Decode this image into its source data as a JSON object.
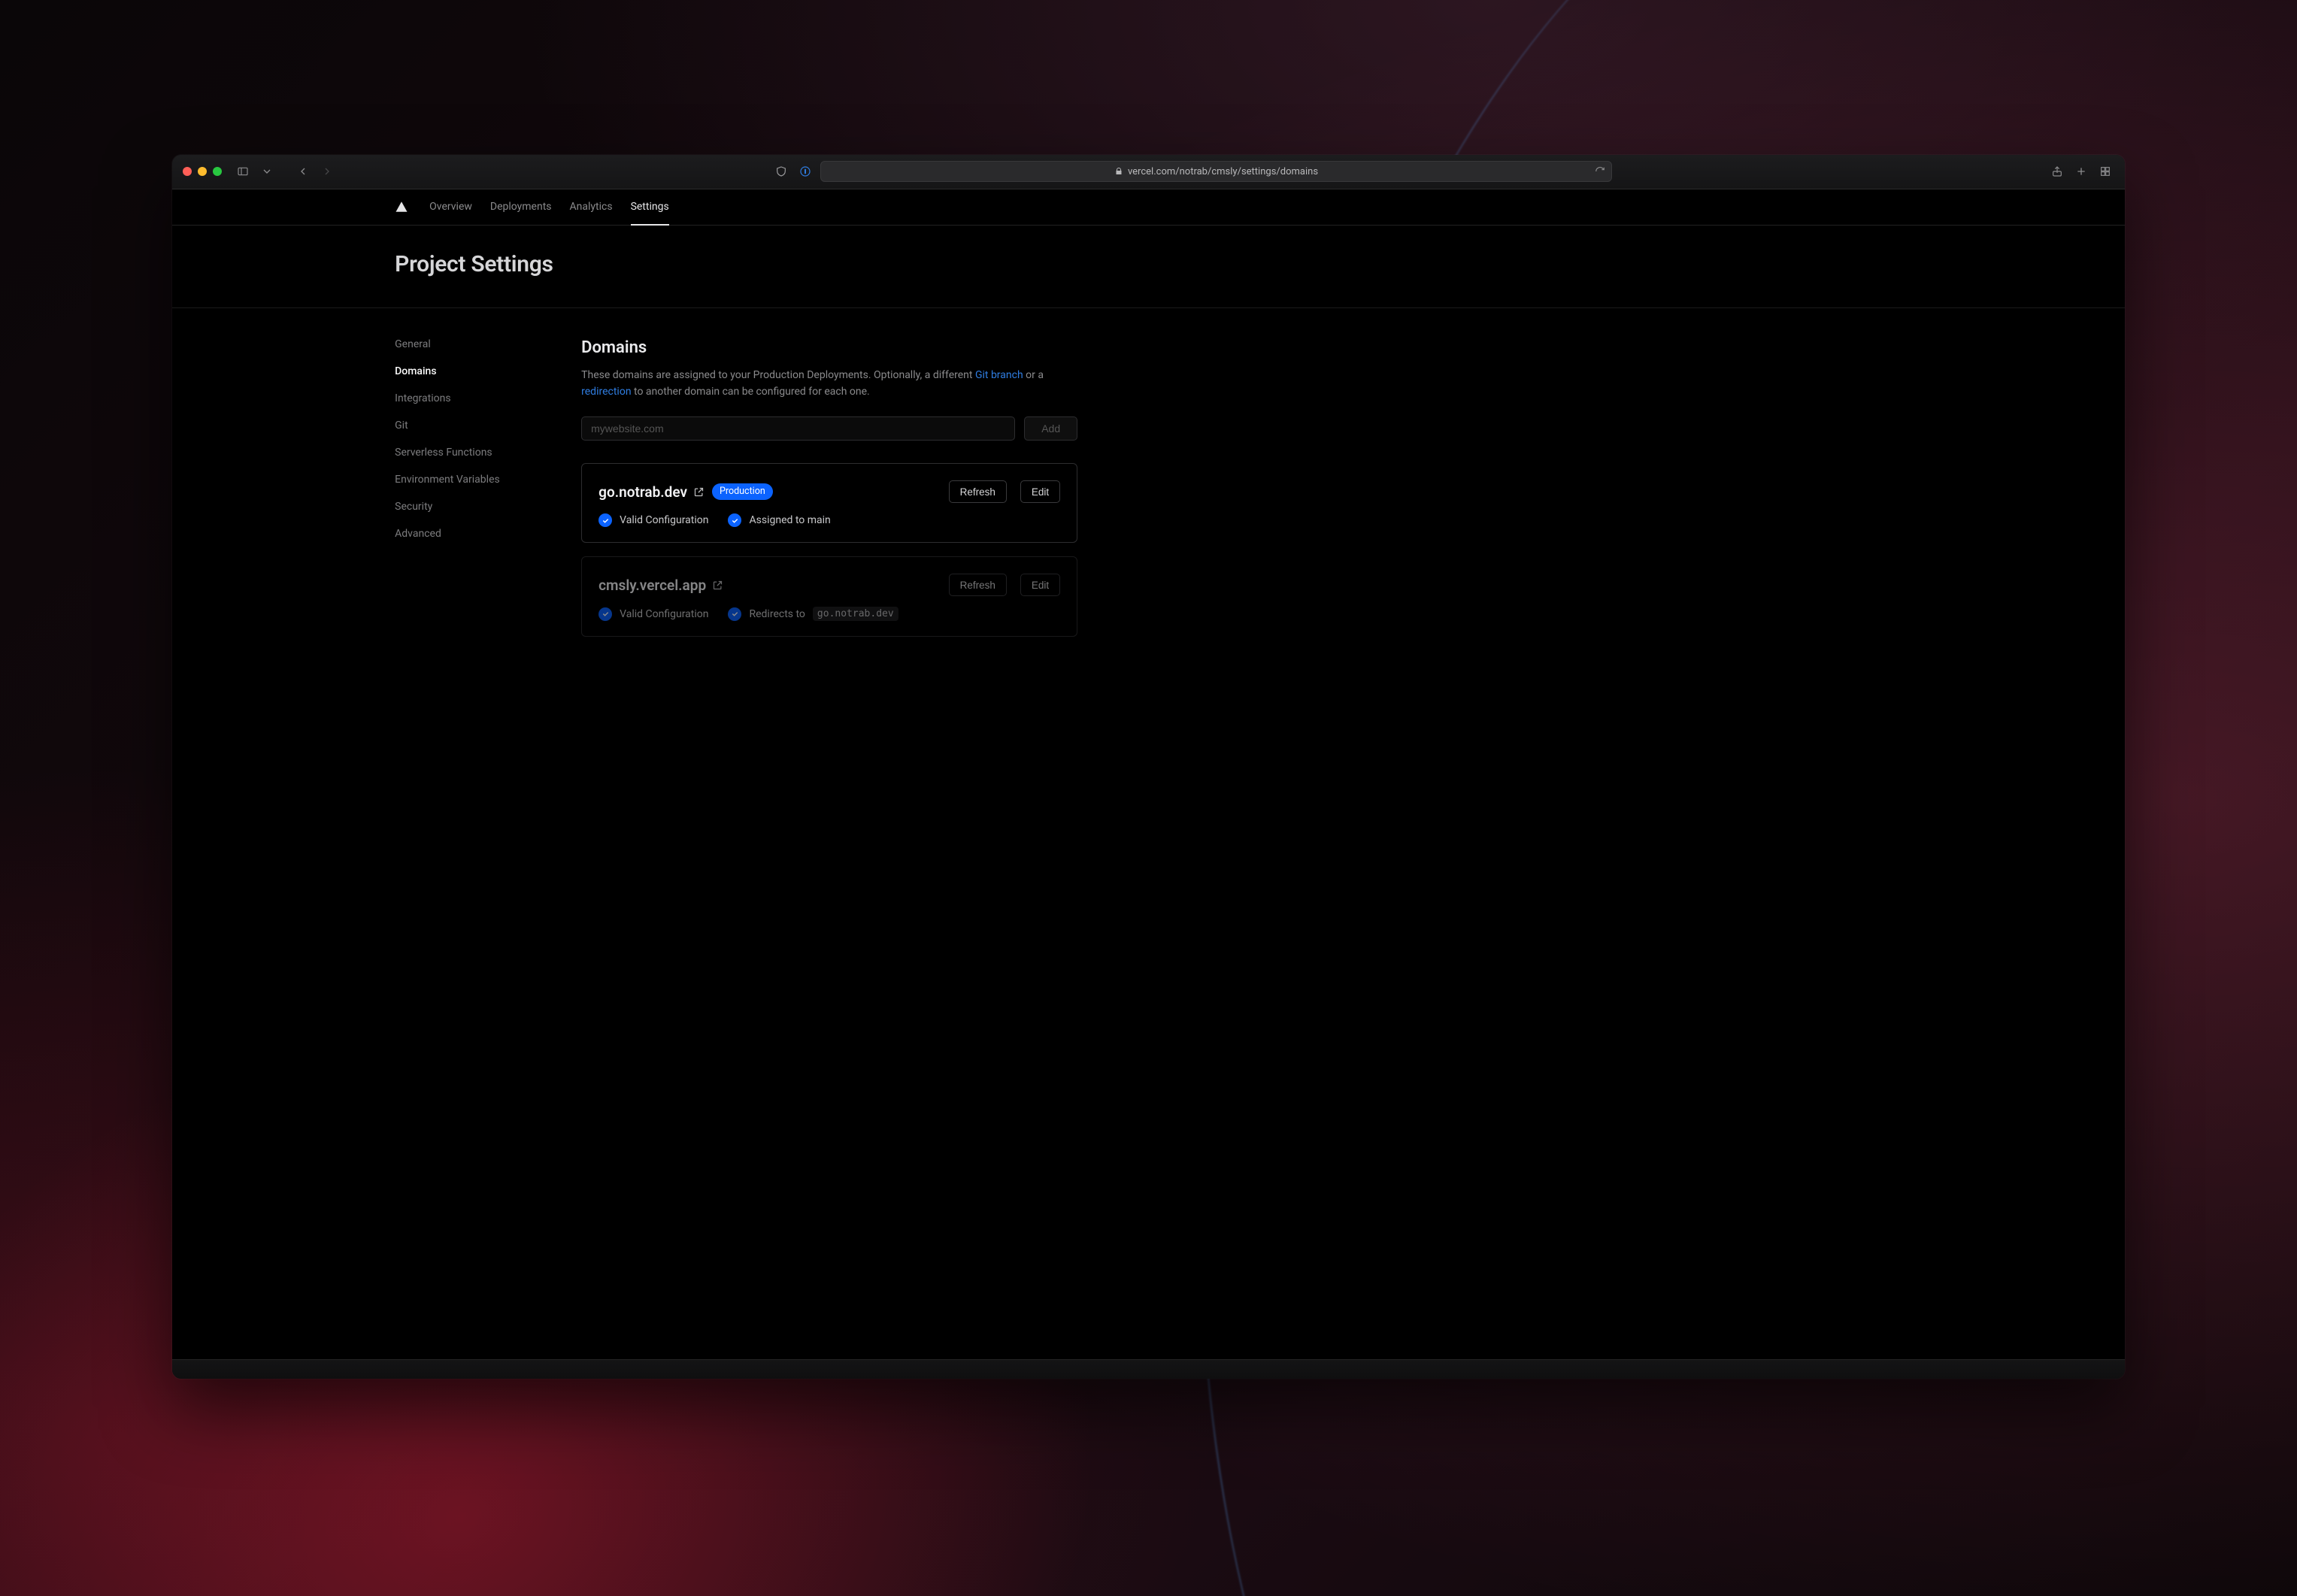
{
  "browser": {
    "url_display": "vercel.com/notrab/cmsly/settings/domains"
  },
  "nav": {
    "items": [
      {
        "label": "Overview",
        "active": false
      },
      {
        "label": "Deployments",
        "active": false
      },
      {
        "label": "Analytics",
        "active": false
      },
      {
        "label": "Settings",
        "active": true
      }
    ]
  },
  "page_title": "Project Settings",
  "sidenav": {
    "items": [
      {
        "label": "General",
        "active": false
      },
      {
        "label": "Domains",
        "active": true
      },
      {
        "label": "Integrations",
        "active": false
      },
      {
        "label": "Git",
        "active": false
      },
      {
        "label": "Serverless Functions",
        "active": false
      },
      {
        "label": "Environment Variables",
        "active": false
      },
      {
        "label": "Security",
        "active": false
      },
      {
        "label": "Advanced",
        "active": false
      }
    ]
  },
  "section": {
    "heading": "Domains",
    "desc_pre": "These domains are assigned to your Production Deployments. Optionally, a different ",
    "desc_link1": "Git branch",
    "desc_mid": " or a ",
    "desc_link2": "redirection",
    "desc_post": " to another domain can be configured for each one.",
    "input_placeholder": "mywebsite.com",
    "add_button": "Add"
  },
  "domains": [
    {
      "name": "go.notrab.dev",
      "badge": "Production",
      "refresh": "Refresh",
      "edit": "Edit",
      "check1": "Valid Configuration",
      "check2": "Assigned to main",
      "redirect_target": "",
      "dim": false
    },
    {
      "name": "cmsly.vercel.app",
      "badge": "",
      "refresh": "Refresh",
      "edit": "Edit",
      "check1": "Valid Configuration",
      "check2": "Redirects to ",
      "redirect_target": "go.notrab.dev",
      "dim": true
    }
  ]
}
